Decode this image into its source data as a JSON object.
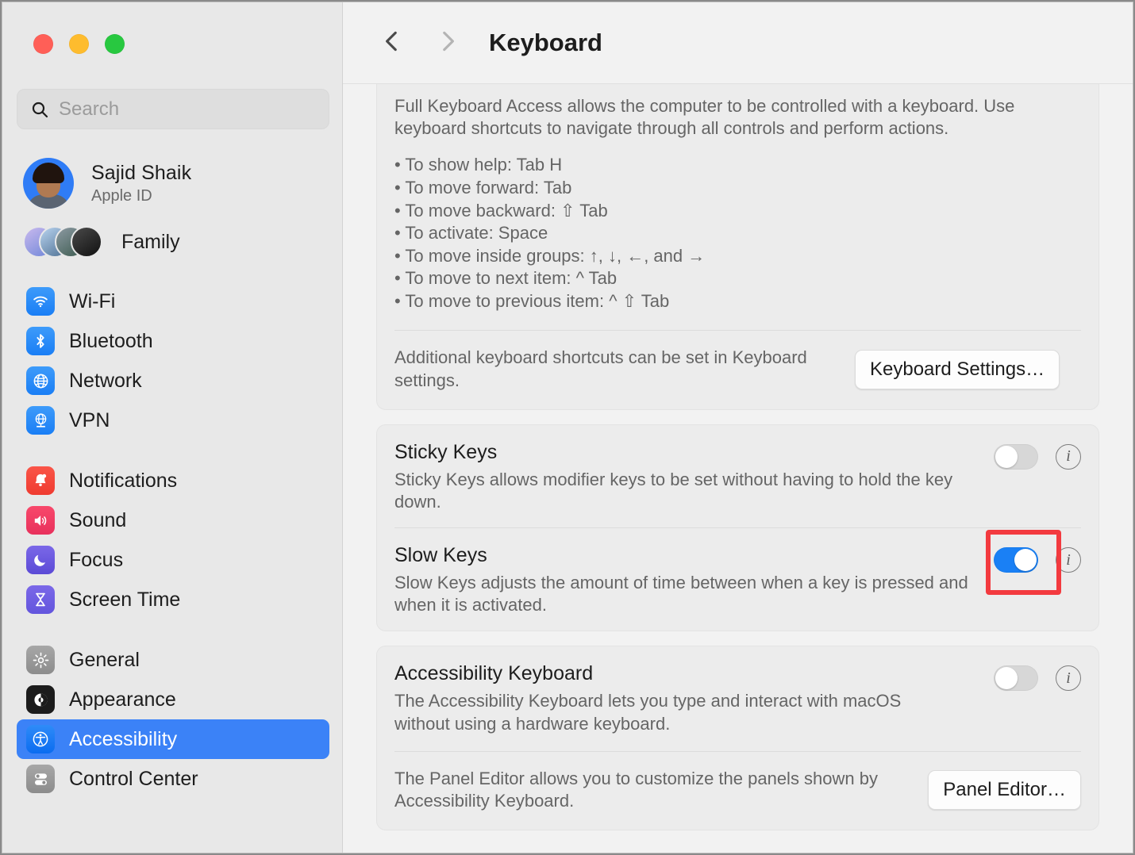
{
  "window": {
    "traffic_lights": [
      "close",
      "minimize",
      "maximize"
    ]
  },
  "sidebar": {
    "search": {
      "placeholder": "Search",
      "value": "",
      "icon": "search-icon"
    },
    "account": {
      "name": "Sajid Shaik",
      "subtitle": "Apple ID",
      "avatar": "user-avatar"
    },
    "family": {
      "label": "Family",
      "avatar_count": 4
    },
    "groups": [
      {
        "items": [
          {
            "label": "Wi-Fi",
            "icon": "wifi-icon",
            "selected": false
          },
          {
            "label": "Bluetooth",
            "icon": "bluetooth-icon",
            "selected": false
          },
          {
            "label": "Network",
            "icon": "network-globe-icon",
            "selected": false
          },
          {
            "label": "VPN",
            "icon": "vpn-globe-icon",
            "selected": false
          }
        ]
      },
      {
        "items": [
          {
            "label": "Notifications",
            "icon": "bell-icon",
            "selected": false
          },
          {
            "label": "Sound",
            "icon": "speaker-icon",
            "selected": false
          },
          {
            "label": "Focus",
            "icon": "moon-icon",
            "selected": false
          },
          {
            "label": "Screen Time",
            "icon": "hourglass-icon",
            "selected": false
          }
        ]
      },
      {
        "items": [
          {
            "label": "General",
            "icon": "gear-icon",
            "selected": false
          },
          {
            "label": "Appearance",
            "icon": "appearance-contrast-icon",
            "selected": false
          },
          {
            "label": "Accessibility",
            "icon": "accessibility-icon",
            "selected": true
          },
          {
            "label": "Control Center",
            "icon": "control-center-icon",
            "selected": false
          }
        ]
      }
    ]
  },
  "header": {
    "title": "Keyboard",
    "back_icon": "chevron-left-icon",
    "forward_icon": "chevron-right-icon"
  },
  "main": {
    "full_keyboard_access": {
      "description": "Full Keyboard Access allows the computer to be controlled with a keyboard. Use keyboard shortcuts to navigate through all controls and perform actions.",
      "bullets": [
        "• To show help: Tab H",
        "• To move forward: Tab",
        "• To move backward: ⇧ Tab",
        "• To activate: Space",
        "• To move inside groups: ↑, ↓, ←, and →",
        "• To move to next item: ^ Tab",
        "• To move to previous item: ^ ⇧ Tab"
      ],
      "footer_text": "Additional keyboard shortcuts can be set in Keyboard settings.",
      "button_label": "Keyboard Settings…"
    },
    "sticky_keys": {
      "title": "Sticky Keys",
      "description": "Sticky Keys allows modifier keys to be set without having to hold the key down.",
      "toggle_on": false,
      "info_icon": "info-icon"
    },
    "slow_keys": {
      "title": "Slow Keys",
      "description": "Slow Keys adjusts the amount of time between when a key is pressed and when it is activated.",
      "toggle_on": true,
      "info_icon": "info-icon",
      "highlighted": true,
      "highlight_color": "#f33a3f"
    },
    "accessibility_keyboard": {
      "title": "Accessibility Keyboard",
      "description": "The Accessibility Keyboard lets you type and interact with macOS without using a hardware keyboard.",
      "toggle_on": false,
      "info_icon": "info-icon",
      "panel_editor_text": "The Panel Editor allows you to customize the panels shown by Accessibility Keyboard.",
      "panel_editor_button": "Panel Editor…"
    }
  },
  "colors": {
    "accent": "#1a80f5",
    "selection": "#3b82f7",
    "highlight": "#f33a3f"
  }
}
